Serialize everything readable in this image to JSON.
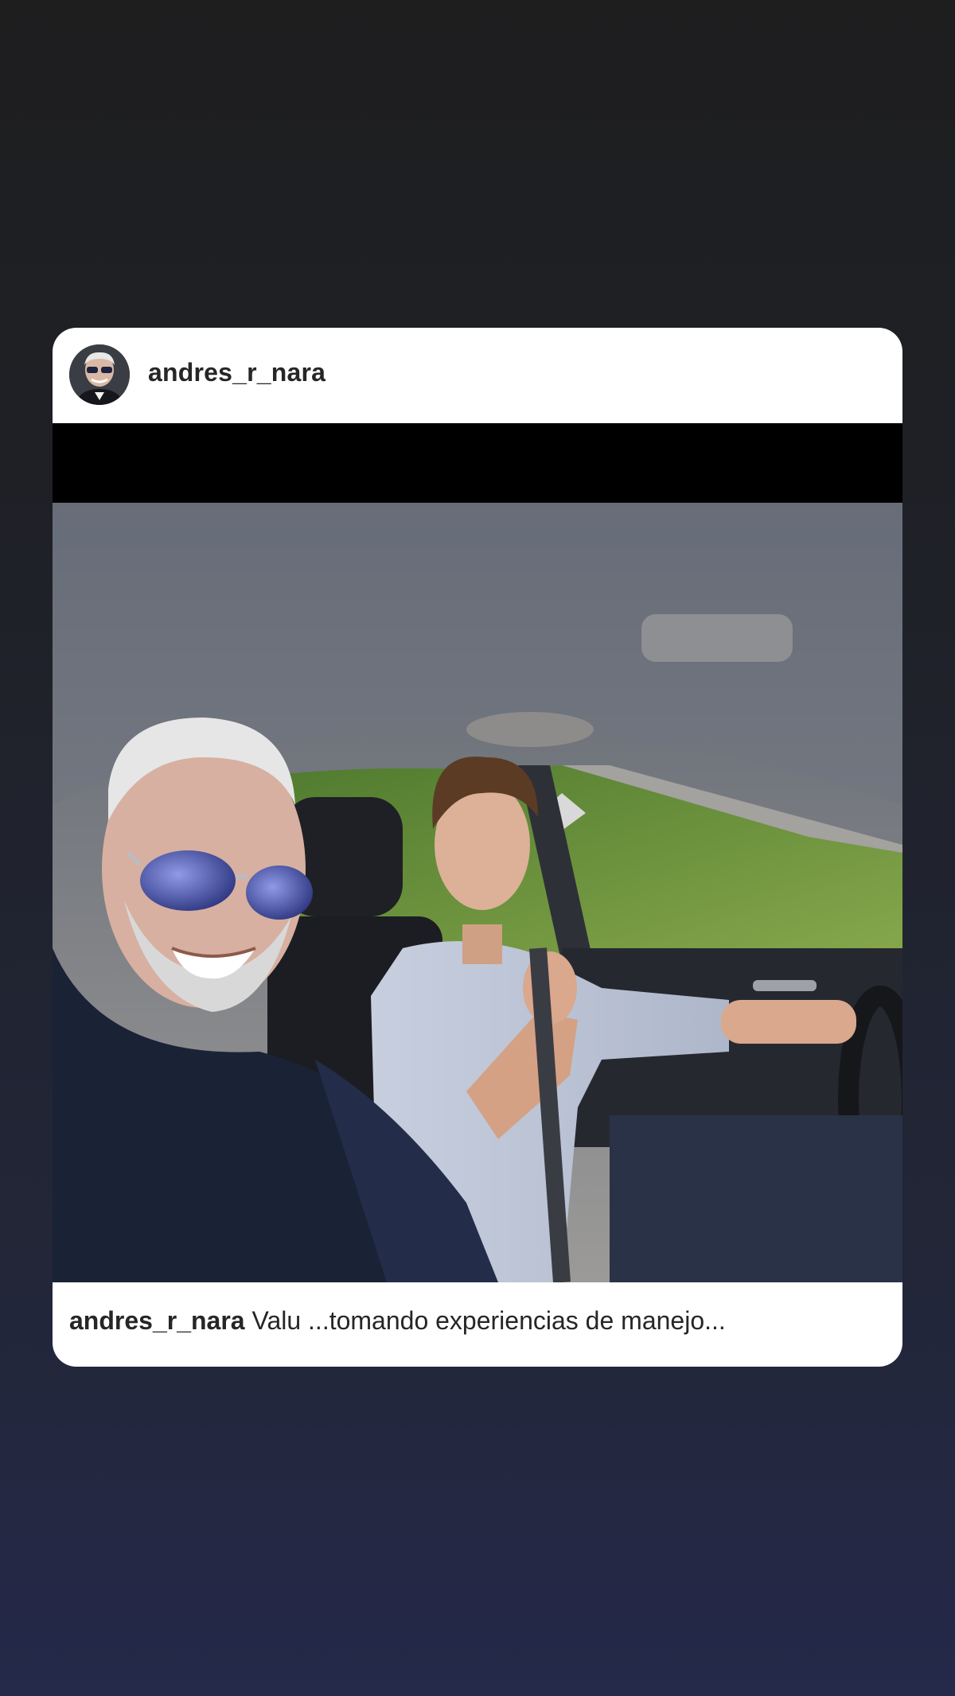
{
  "post": {
    "username": "andres_r_nara",
    "caption_user": "andres_r_nara",
    "caption_text": "Valu ...tomando experiencias de manejo..."
  },
  "icons": {
    "avatar": "profile-photo"
  },
  "colors": {
    "card_bg": "#ffffff",
    "text": "#262626"
  }
}
